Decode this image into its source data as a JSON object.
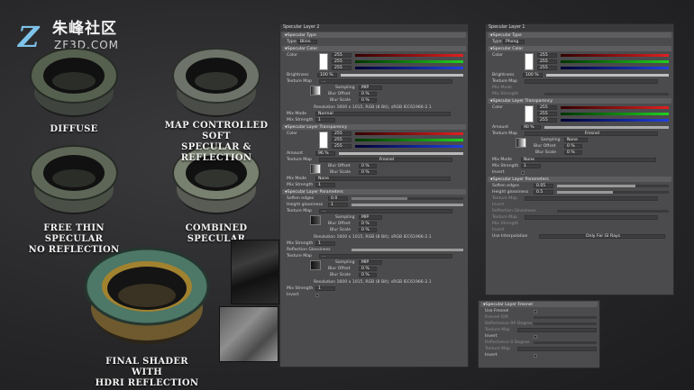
{
  "logo": {
    "mark": "Z",
    "cn": "朱峰社区",
    "en": "ZF3D.COM"
  },
  "captions": {
    "diffuse": [
      "DIFFUSE"
    ],
    "map_controlled": [
      "MAP CONTROLLED SOFT",
      "SPECULAR & REFLECTION"
    ],
    "free_thin": [
      "FREE THIN SPECULAR",
      "NO REFLECTION"
    ],
    "combined": [
      "COMBINED SPECULAR"
    ],
    "final": [
      "FINAL SHADER WITH",
      "HDRI REFLECTION"
    ]
  },
  "panel2": {
    "title": "Specular Layer 2",
    "sec_type": "Specular Type",
    "type_label": "Type",
    "type_value": "Blinn",
    "sec_color": "Specular Color",
    "color_label": "Color",
    "rgb": [
      "255",
      "255",
      "255"
    ],
    "brightness_label": "Brightness",
    "brightness_value": "100 %",
    "texture_label": "Texture Map",
    "texture_value": "...",
    "sampling_label": "Sampling",
    "sampling_value": "MIP",
    "blur_offset_label": "Blur Offset",
    "blur_offset_value": "0 %",
    "blur_scale_label": "Blur Scale",
    "blur_scale_value": "0 %",
    "resolution1": "Resolution 1600 x 1015, RGB (8 Bit), sRGB IEC61966-2.1",
    "mix_mode_label": "Mix Mode",
    "mix_mode_value": "Normal",
    "mix_strength_label": "Mix Strength",
    "mix_strength_value": "1",
    "sec_transp": "Specular Layer Transparency",
    "transp_color_label": "Color",
    "transp_rgb": [
      "255",
      "255",
      "255"
    ],
    "amount_label": "Amount",
    "amount_value": "96 %",
    "tex_label2": "Texture Map",
    "fresnel": "Fresnel",
    "blur_offset2": "0 %",
    "blur_scale2": "0 %",
    "mix_mode2": "None",
    "mix_strength2": "1",
    "sec_params": "Specular Layer Parameters",
    "soften_label": "Soften edges",
    "soften_value": "0.0",
    "height_label": "Height glossiness",
    "height_value": "1",
    "tex_label3": "Texture Map",
    "sampling3": "MIP",
    "blur_offset3": "0 %",
    "blur_scale3": "0 %",
    "resolution2": "Resolution 1600 x 1015, RGB (8 Bit), sRGB IEC61966-2.1",
    "mix_strength3": "1",
    "refl_label": "Reflection Glossiness",
    "tex_label4": "Texture Map",
    "sampling4": "MIP",
    "blur_offset4": "0 %",
    "blur_scale4": "0 %",
    "resolution3": "Resolution 1600 x 1015, RGB (8 Bit), sRGB IEC61966-2.1",
    "mix_strength4": "1",
    "invert_label": "Invert"
  },
  "panel1": {
    "title": "Specular Layer 1",
    "sec_type": "Specular Type",
    "type_label": "Type",
    "type_value": "Phong",
    "sec_color": "Specular Color",
    "color_label": "Color",
    "rgb": [
      "255",
      "255",
      "255"
    ],
    "brightness_label": "Brightness",
    "brightness_value": "100 %",
    "texture_label": "Texture Map",
    "mix_mode_label": "Mix Mode",
    "mix_strength_label": "Mix Strength",
    "sec_transp": "Specular Layer Transparency",
    "transp_color_label": "Color",
    "transp_rgb": [
      "255",
      "255",
      "255"
    ],
    "amount_label": "Amount",
    "amount_value": "90 %",
    "tex_label2": "Texture Map",
    "fresnel": "Fresnel",
    "sampling_label": "Sampling",
    "sampling_value": "None",
    "blur_offset_label": "Blur Offset",
    "blur_offset_value": "0 %",
    "blur_scale_label": "Blur Scale",
    "blur_scale_value": "0 %",
    "mix_mode2": "None",
    "mix_strength2": "1",
    "invert_label": "Invert",
    "sec_params": "Specular Layer Parameters",
    "soften_label": "Soften edges",
    "soften_value": "0.05",
    "height_label": "Height glossiness",
    "height_value": "0.5",
    "tex_label3": "Texture Map",
    "refl_label": "Reflection Glossiness",
    "tex_label4": "Texture Map",
    "strength_label": "Mix Strength",
    "use_interp_label": "Use Interpolation",
    "use_interp_value": "Only For GI Rays"
  },
  "panel3": {
    "title": "Specular Layer Fresnel",
    "use_fresnel": "Use Fresnel",
    "fresnel_ior": "Fresnel IOR",
    "refl_90": "Reflectance 90 Degree",
    "tex1": "Texture Map",
    "invert1": "Invert",
    "refl_0": "Reflectance 0 Degree",
    "tex2": "Texture Map",
    "invert2": "Invert"
  }
}
